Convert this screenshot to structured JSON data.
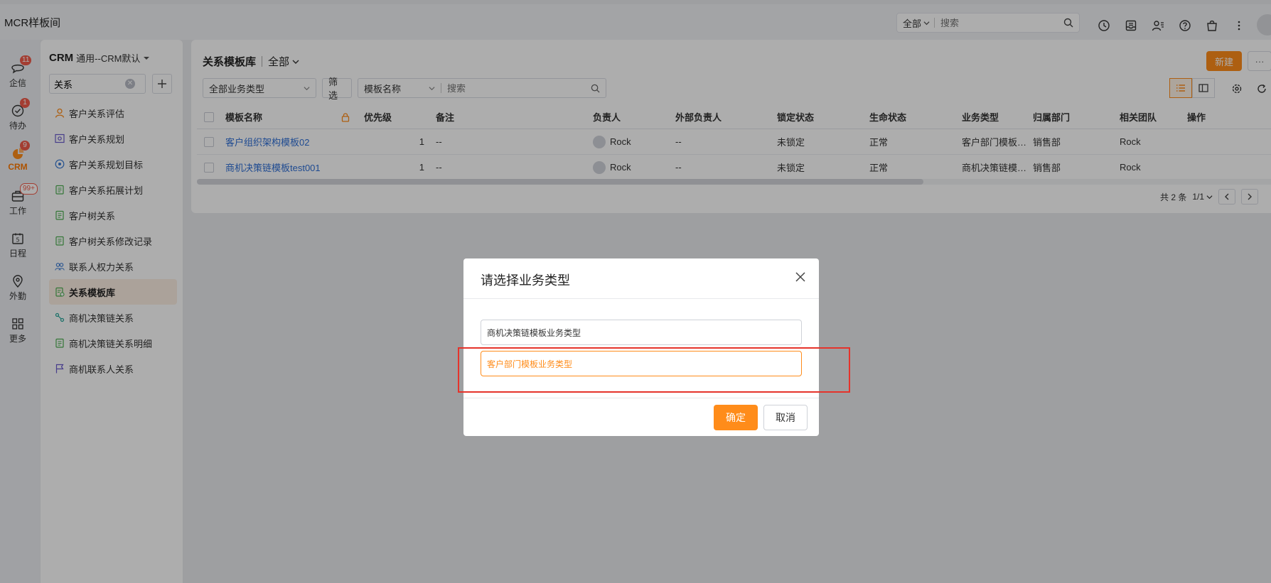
{
  "app": {
    "title": "MCR样板间"
  },
  "topbar": {
    "scope": "全部",
    "search_placeholder": "搜索"
  },
  "rail": [
    {
      "label": "企信",
      "badge": "11",
      "icon": "chat-icon"
    },
    {
      "label": "待办",
      "badge": "1",
      "icon": "todo-icon"
    },
    {
      "label": "CRM",
      "badge": "9",
      "icon": "crm-icon"
    },
    {
      "label": "工作",
      "badge": "99+",
      "icon": "work-icon"
    },
    {
      "label": "日程",
      "badge": "",
      "icon": "calendar-icon"
    },
    {
      "label": "外勤",
      "badge": "",
      "icon": "location-icon"
    },
    {
      "label": "更多",
      "badge": "",
      "icon": "grid-icon"
    }
  ],
  "nav": {
    "title": "CRM",
    "subtitle": "通用--CRM默认",
    "search_value": "关系",
    "items": [
      {
        "label": "客户关系评估",
        "icon": "person-icon"
      },
      {
        "label": "客户关系规划",
        "icon": "board-icon"
      },
      {
        "label": "客户关系规划目标",
        "icon": "target-icon"
      },
      {
        "label": "客户关系拓展计划",
        "icon": "clipboard-icon"
      },
      {
        "label": "客户树关系",
        "icon": "clipboard-icon"
      },
      {
        "label": "客户树关系修改记录",
        "icon": "clipboard-icon"
      },
      {
        "label": "联系人权力关系",
        "icon": "group-icon"
      },
      {
        "label": "关系模板库",
        "icon": "template-icon"
      },
      {
        "label": "商机决策链关系",
        "icon": "chain-icon"
      },
      {
        "label": "商机决策链关系明细",
        "icon": "clipboard-icon"
      },
      {
        "label": "商机联系人关系",
        "icon": "flag-icon"
      }
    ]
  },
  "main": {
    "title": "关系模板库",
    "scope": "全部",
    "new_label": "新建",
    "more_label": "···",
    "filter": {
      "type_select": "全部业务类型",
      "filter_label": "筛选",
      "field_select": "模板名称",
      "search_placeholder": "搜索"
    },
    "columns": [
      "模板名称",
      "优先级",
      "备注",
      "负责人",
      "外部负责人",
      "锁定状态",
      "生命状态",
      "业务类型",
      "归属部门",
      "相关团队",
      "操作"
    ],
    "rows": [
      {
        "name": "客户组织架构模板02",
        "priority": "1",
        "remark": "--",
        "owner": "Rock",
        "ext_owner": "--",
        "lock": "未锁定",
        "life": "正常",
        "biz_type": "客户部门模板…",
        "dept": "销售部",
        "team": "Rock"
      },
      {
        "name": "商机决策链模板test001",
        "priority": "1",
        "remark": "--",
        "owner": "Rock",
        "ext_owner": "--",
        "lock": "未锁定",
        "life": "正常",
        "biz_type": "商机决策链模…",
        "dept": "销售部",
        "team": "Rock"
      }
    ],
    "pager": {
      "total": "共 2 条",
      "page": "1/1"
    }
  },
  "dialog": {
    "title": "请选择业务类型",
    "options": [
      "商机决策链模板业务类型",
      "客户部门模板业务类型"
    ],
    "selected_index": 1,
    "ok_label": "确定",
    "cancel_label": "取消"
  },
  "colors": {
    "accent": "#ff8c1a",
    "link": "#2f6fd6",
    "badge": "#f05a4a",
    "highlight": "#e5332b"
  }
}
